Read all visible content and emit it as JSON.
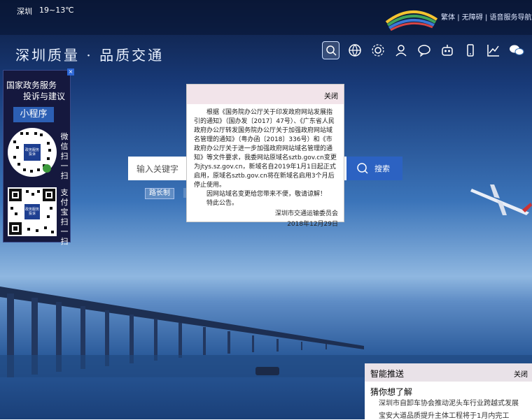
{
  "header": {
    "city": "深圳",
    "weather": "19~13℃",
    "links": [
      "繁体",
      "无障碍",
      "语音服务导航"
    ],
    "separator": "|"
  },
  "site": {
    "title": "深圳质量 · 品质交通"
  },
  "nav_icons": [
    "search-icon",
    "globe-icon",
    "sun-icon",
    "user-icon",
    "chat-icon",
    "robot-icon",
    "phone-icon",
    "chart-icon",
    "wechat-icon"
  ],
  "sidebar": {
    "close_label": "×",
    "title_line1": "国家政务服务",
    "title_line2": "投诉与建议",
    "mini_label": "小程序",
    "qr1_label": "政务服务投诉",
    "qr1_caption": "微信扫一扫",
    "qr2_label": "政务服务投诉",
    "qr2_caption": "支付宝扫一扫"
  },
  "search": {
    "placeholder": "输入关键字",
    "button_label": "搜索",
    "tag": "路长制"
  },
  "notice": {
    "close_label": "关闭",
    "paragraph1": "根据《国务院办公厅关于印发政府网站发展指引的通知》（国办发〔2017〕47号）、《广东省人民政府办公厅转发国务院办公厅关于加强政府网站域名管理的通知》（粤办函〔2018〕336号）和《市政府办公厅关于进一步加强政府网站域名管理的通知》等文件要求，我委网站原域名sztb.gov.cn变更为jtys.sz.gov.cn，新域名自2019年1月1日起正式启用，原域名sztb.gov.cn将在新域名启用3个月后停止使用。",
    "paragraph2": "因网站域名变更给您带来不便，敬请谅解！",
    "paragraph3": "特此公告。",
    "signature": "深圳市交通运输委员会",
    "date": "2018年12月29日"
  },
  "smart_push": {
    "title": "智能推送",
    "close_label": "关闭",
    "subtitle": "猜你想了解",
    "items": [
      "深圳市自卸车协会推动泥头车行业跨越式发展",
      "宝安大道品质提升主体工程将于1月内完工"
    ]
  },
  "colors": {
    "accent": "#2c62c2",
    "sidebar_bg": "#15183e",
    "modal_header": "#f2e4ea"
  }
}
